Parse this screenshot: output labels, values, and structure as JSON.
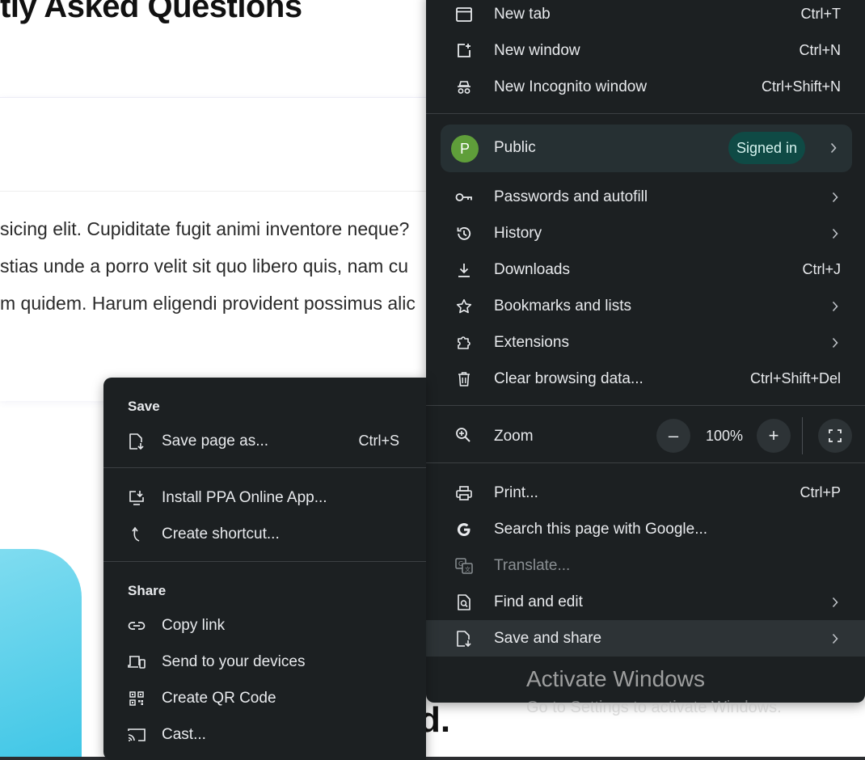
{
  "background": {
    "title": "tly Asked Questions",
    "paragraph_lines": [
      "sicing elit. Cupiditate fugit animi inventore neque?",
      "stias unde a porro velit sit quo libero quis, nam cu",
      "m quidem. Harum eligendi provident possimus alic"
    ],
    "bottom_text": "d."
  },
  "main_menu": {
    "new_tab": {
      "label": "New tab",
      "shortcut": "Ctrl+T"
    },
    "new_window": {
      "label": "New window",
      "shortcut": "Ctrl+N"
    },
    "new_incognito": {
      "label": "New Incognito window",
      "shortcut": "Ctrl+Shift+N"
    },
    "profile": {
      "initial": "P",
      "name": "Public",
      "status": "Signed in"
    },
    "passwords": {
      "label": "Passwords and autofill"
    },
    "history": {
      "label": "History"
    },
    "downloads": {
      "label": "Downloads",
      "shortcut": "Ctrl+J"
    },
    "bookmarks": {
      "label": "Bookmarks and lists"
    },
    "extensions": {
      "label": "Extensions"
    },
    "clear_data": {
      "label": "Clear browsing data...",
      "shortcut": "Ctrl+Shift+Del"
    },
    "zoom": {
      "label": "Zoom",
      "minus": "–",
      "value": "100%",
      "plus": "+"
    },
    "print": {
      "label": "Print...",
      "shortcut": "Ctrl+P"
    },
    "search_google": {
      "label": "Search this page with Google..."
    },
    "translate": {
      "label": "Translate..."
    },
    "find_edit": {
      "label": "Find and edit"
    },
    "save_share": {
      "label": "Save and share"
    }
  },
  "watermark": {
    "title": "Activate Windows",
    "subtitle": "Go to Settings to activate Windows."
  },
  "sub_menu": {
    "save_header": "Save",
    "save_page": {
      "label": "Save page as...",
      "shortcut": "Ctrl+S"
    },
    "install_app": {
      "label": "Install PPA Online App..."
    },
    "create_shortcut": {
      "label": "Create shortcut..."
    },
    "share_header": "Share",
    "copy_link": {
      "label": "Copy link"
    },
    "send_devices": {
      "label": "Send to your devices"
    },
    "qr_code": {
      "label": "Create QR Code"
    },
    "cast": {
      "label": "Cast..."
    }
  },
  "colors": {
    "menu_bg": "#1c2022",
    "menu_text": "#e8eaed",
    "profile_bg": "#263033",
    "avatar_bg": "#5f9e3a",
    "badge_bg": "#0f4a45",
    "highlight_bg": "#2d3336"
  }
}
